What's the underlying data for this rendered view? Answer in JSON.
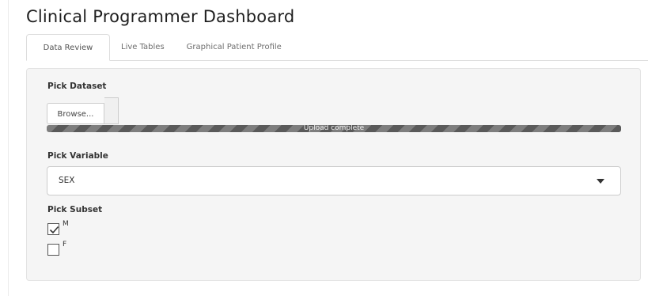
{
  "app": {
    "title": "Clinical Programmer Dashboard"
  },
  "tabs": [
    {
      "label": "Data Review",
      "active": true
    },
    {
      "label": "Live Tables",
      "active": false
    },
    {
      "label": "Graphical Patient Profile",
      "active": false
    }
  ],
  "dataset": {
    "label": "Pick Dataset",
    "browse_label": "Browse...",
    "upload_status": "Upload complete",
    "progress_percent": 100
  },
  "variable": {
    "label": "Pick Variable",
    "selected": "SEX"
  },
  "subset": {
    "label": "Pick Subset",
    "options": [
      {
        "label": "M",
        "checked": true
      },
      {
        "label": "F",
        "checked": false
      }
    ]
  },
  "colors": {
    "progress_bar": "#5a5a5a",
    "panel_background": "#f5f5f5",
    "title_text": "#1f1f1f"
  }
}
